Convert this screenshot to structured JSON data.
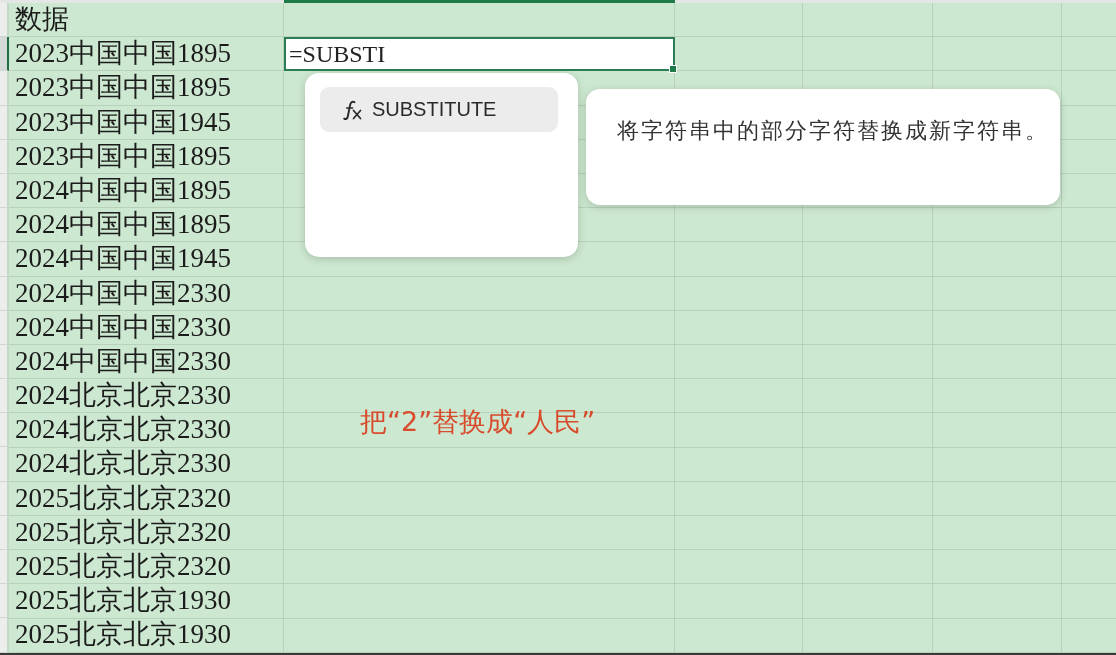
{
  "sheet": {
    "header": "数据",
    "rows": [
      {
        "value": "2023中国中国1895",
        "selected": true
      },
      {
        "value": "2023中国中国1895",
        "selected": false
      },
      {
        "value": "2023中国中国1945",
        "selected": false
      },
      {
        "value": "2023中国中国1895",
        "selected": false
      },
      {
        "value": "2024中国中国1895",
        "selected": false
      },
      {
        "value": "2024中国中国1895",
        "selected": false
      },
      {
        "value": "2024中国中国1945",
        "selected": false
      },
      {
        "value": "2024中国中国2330",
        "selected": false
      },
      {
        "value": "2024中国中国2330",
        "selected": false
      },
      {
        "value": "2024中国中国2330",
        "selected": false
      },
      {
        "value": "2024北京北京2330",
        "selected": false
      },
      {
        "value": "2024北京北京2330",
        "selected": false
      },
      {
        "value": "2024北京北京2330",
        "selected": false
      },
      {
        "value": "2025北京北京2320",
        "selected": false
      },
      {
        "value": "2025北京北京2320",
        "selected": false
      },
      {
        "value": "2025北京北京2320",
        "selected": false
      },
      {
        "value": "2025北京北京1930",
        "selected": false
      },
      {
        "value": "2025北京北京1930",
        "selected": false
      }
    ]
  },
  "cell_editor": {
    "value": "=SUBSTI"
  },
  "autocomplete": {
    "items": [
      {
        "name": "SUBSTITUTE",
        "selected": true
      }
    ]
  },
  "function_tooltip": {
    "description": "将字符串中的部分字符替换成新字符串。"
  },
  "annotation": {
    "text": "把“2”替换成“人民”"
  }
}
